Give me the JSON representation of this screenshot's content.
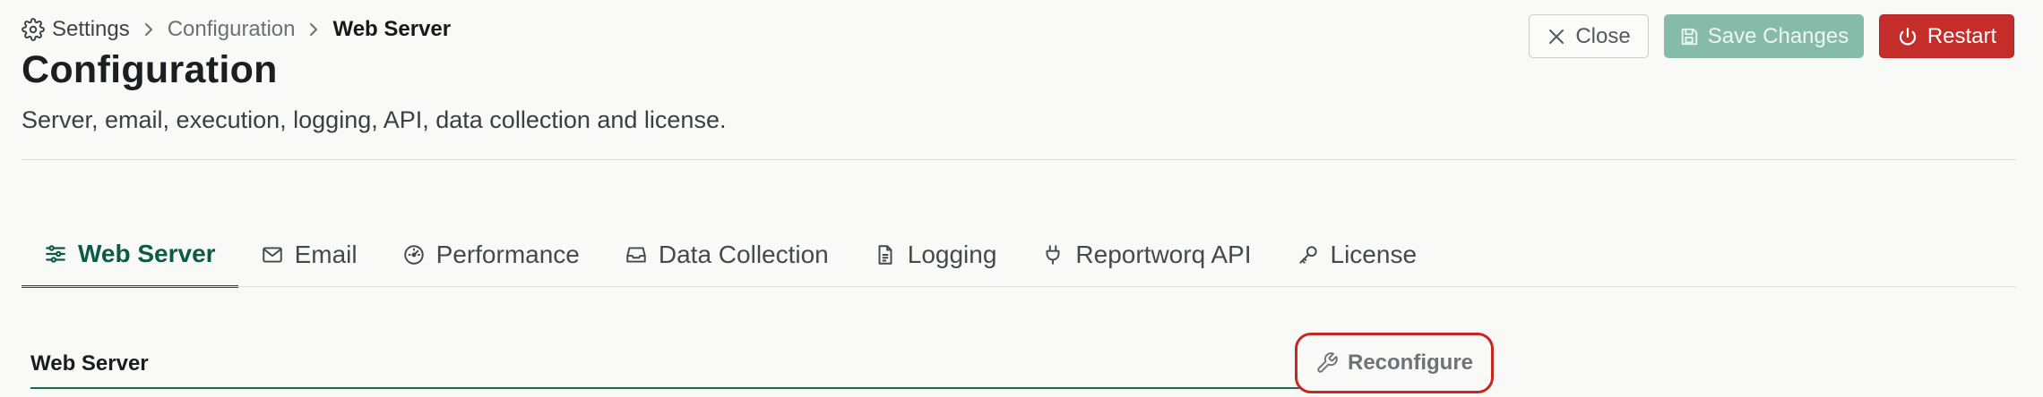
{
  "breadcrumb": {
    "items": [
      {
        "label": "Settings",
        "icon": "gear-icon"
      },
      {
        "label": "Configuration"
      },
      {
        "label": "Web Server"
      }
    ]
  },
  "header": {
    "title": "Configuration",
    "subtitle": "Server, email, execution, logging, API, data collection and license."
  },
  "actions": {
    "close_label": "Close",
    "save_label": "Save Changes",
    "restart_label": "Restart"
  },
  "tabs": [
    {
      "label": "Web Server",
      "icon": "sliders-icon",
      "active": true
    },
    {
      "label": "Email",
      "icon": "envelope-icon"
    },
    {
      "label": "Performance",
      "icon": "speedometer-icon"
    },
    {
      "label": "Data Collection",
      "icon": "inbox-icon"
    },
    {
      "label": "Logging",
      "icon": "document-icon"
    },
    {
      "label": "Reportworq API",
      "icon": "plug-icon"
    },
    {
      "label": "License",
      "icon": "key-icon"
    }
  ],
  "section": {
    "title": "Web Server",
    "reconfigure_label": "Reconfigure",
    "reconfigure_icon": "wrench-icon"
  },
  "colors": {
    "accent": "#0d5a45",
    "save": "#87bba9",
    "danger": "#c42d2a",
    "highlight": "#c82620"
  }
}
